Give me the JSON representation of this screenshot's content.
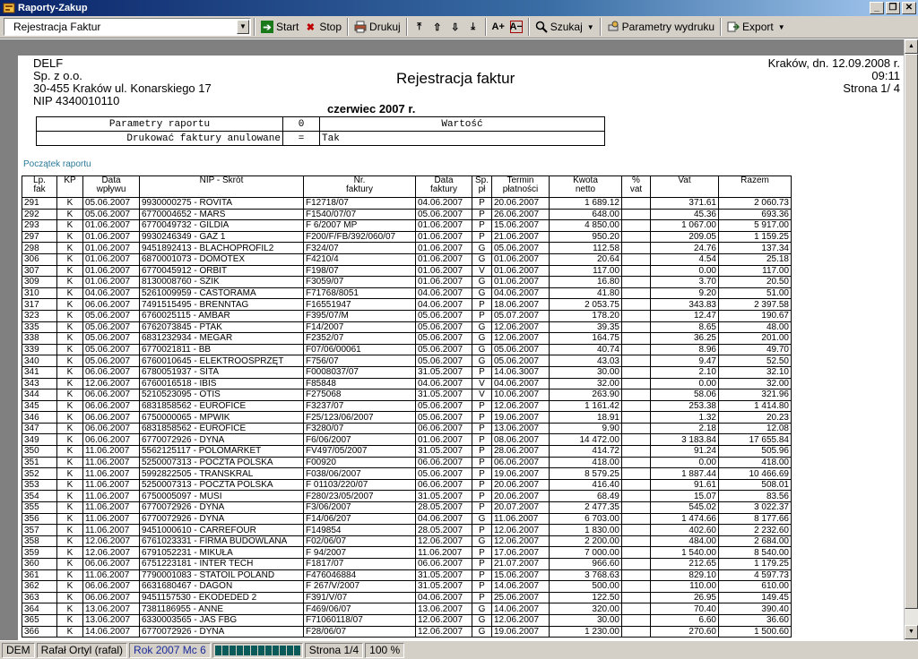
{
  "window": {
    "title": "Raporty-Zakup"
  },
  "toolbar": {
    "report_select": "Rejestracja Faktur",
    "start": "Start",
    "stop": "Stop",
    "print": "Drukuj",
    "font_up": "A+",
    "font_down": "A−",
    "search": "Szukaj",
    "print_params": "Parametry wydruku",
    "export": "Export"
  },
  "page": {
    "company": [
      "DELF",
      "Sp. z o.o.",
      "30-455 Kraków  ul. Konarskiego 17",
      "NIP  4340010110"
    ],
    "title": "Rejestracja faktur",
    "place_date": "Kraków, dn. 12.09.2008 r.",
    "time": "09:11",
    "page_label": "Strona 1/ 4",
    "period": "czerwiec 2007 r.",
    "params": {
      "header": [
        "Parametry raportu",
        "0",
        "Wartość"
      ],
      "row": [
        "Drukować faktury anulowane",
        "=",
        "Tak"
      ]
    },
    "start_label": "Początek raportu"
  },
  "table": {
    "headers": [
      [
        "Lp.",
        "fak"
      ],
      [
        "KP",
        ""
      ],
      [
        "Data",
        "wpływu"
      ],
      [
        "NIP - Skrót",
        ""
      ],
      [
        "Nr.",
        "faktury"
      ],
      [
        "Data",
        "faktury"
      ],
      [
        "Sp.",
        "pł"
      ],
      [
        "Termin",
        "płatności"
      ],
      [
        "Kwota",
        "netto"
      ],
      [
        "%",
        "vat"
      ],
      [
        "Vat",
        ""
      ],
      [
        "Razem",
        ""
      ]
    ],
    "rows": [
      [
        "291",
        "K",
        "05.06.2007",
        "9930000275 - ROVITA",
        "F12718/07",
        "04.06.2007",
        "P",
        "20.06.2007",
        "1 689.12",
        "",
        "371.61",
        "2 060.73"
      ],
      [
        "292",
        "K",
        "05.06.2007",
        "6770004652 - MARS",
        "F1540/07/07",
        "05.06.2007",
        "P",
        "26.06.2007",
        "648.00",
        "",
        "45.36",
        "693.36"
      ],
      [
        "293",
        "K",
        "01.06.2007",
        "6770049732 - GILDIA",
        "F 6/2007 MP",
        "01.06.2007",
        "P",
        "15.06.2007",
        "4 850.00",
        "",
        "1 067.00",
        "5 917.00"
      ],
      [
        "297",
        "K",
        "01.06.2007",
        "9930246349 - GAZ 1",
        "F200/F/FB/392/060/07",
        "01.06.2007",
        "P",
        "21.06.2007",
        "950.20",
        "",
        "209.05",
        "1 159.25"
      ],
      [
        "298",
        "K",
        "01.06.2007",
        "9451892413 - BLACHOPROFIL2",
        "F324/07",
        "01.06.2007",
        "G",
        "05.06.2007",
        "112.58",
        "",
        "24.76",
        "137.34"
      ],
      [
        "306",
        "K",
        "01.06.2007",
        "6870001073 - DOMOTEX",
        "F4210/4",
        "01.06.2007",
        "G",
        "01.06.2007",
        "20.64",
        "",
        "4.54",
        "25.18"
      ],
      [
        "307",
        "K",
        "01.06.2007",
        "6770045912 - ORBIT",
        "F198/07",
        "01.06.2007",
        "V",
        "01.06.2007",
        "117.00",
        "",
        "0.00",
        "117.00"
      ],
      [
        "309",
        "K",
        "01.06.2007",
        "8130008760 - SZIK",
        "F3059/07",
        "01.06.2007",
        "G",
        "01.06.2007",
        "16.80",
        "",
        "3.70",
        "20.50"
      ],
      [
        "310",
        "K",
        "04.06.2007",
        "5261009959 - CASTORAMA",
        "F71768/8051",
        "04.06.2007",
        "G",
        "04.06.2007",
        "41.80",
        "",
        "9.20",
        "51.00"
      ],
      [
        "317",
        "K",
        "06.06.2007",
        "7491515495 - BRENNTAG",
        "F16551947",
        "04.06.2007",
        "P",
        "18.06.2007",
        "2 053.75",
        "",
        "343.83",
        "2 397.58"
      ],
      [
        "323",
        "K",
        "05.06.2007",
        "6760025115 - AMBAR",
        "F395/07/M",
        "05.06.2007",
        "P",
        "05.07.2007",
        "178.20",
        "",
        "12.47",
        "190.67"
      ],
      [
        "335",
        "K",
        "05.06.2007",
        "6762073845 - PTAK",
        "F14/2007",
        "05.06.2007",
        "G",
        "12.06.2007",
        "39.35",
        "",
        "8.65",
        "48.00"
      ],
      [
        "338",
        "K",
        "05.06.2007",
        "6831232934 - MEGAR",
        "F2352/07",
        "05.06.2007",
        "G",
        "12.06.2007",
        "164.75",
        "",
        "36.25",
        "201.00"
      ],
      [
        "339",
        "K",
        "05.06.2007",
        "6770021811 - BB",
        "F07/06/00061",
        "05.06.2007",
        "G",
        "05.06.2007",
        "40.74",
        "",
        "8.96",
        "49.70"
      ],
      [
        "340",
        "K",
        "05.06.2007",
        "6760010645 - ELEKTROOSPRZĘT",
        "F756/07",
        "05.06.2007",
        "G",
        "05.06.2007",
        "43.03",
        "",
        "9.47",
        "52.50"
      ],
      [
        "341",
        "K",
        "06.06.2007",
        "6780051937 - SITA",
        "F0008037/07",
        "31.05.2007",
        "P",
        "14.06.3007",
        "30.00",
        "",
        "2.10",
        "32.10"
      ],
      [
        "343",
        "K",
        "12.06.2007",
        "6760016518 - IBIS",
        "F85848",
        "04.06.2007",
        "V",
        "04.06.2007",
        "32.00",
        "",
        "0.00",
        "32.00"
      ],
      [
        "344",
        "K",
        "06.06.2007",
        "5210523095 - OTIS",
        "F275068",
        "31.05.2007",
        "V",
        "10.06.2007",
        "263.90",
        "",
        "58.06",
        "321.96"
      ],
      [
        "345",
        "K",
        "06.06.2007",
        "6831858562 - EUROFICE",
        "F3237/07",
        "05.06.2007",
        "P",
        "12.06.2007",
        "1 161.42",
        "",
        "253.38",
        "1 414.80"
      ],
      [
        "346",
        "K",
        "06.06.2007",
        "6750000065 - MPWIK",
        "F25/123/06/2007",
        "05.06.2007",
        "P",
        "19.06.2007",
        "18.91",
        "",
        "1.32",
        "20.23"
      ],
      [
        "347",
        "K",
        "06.06.2007",
        "6831858562 - EUROFICE",
        "F3280/07",
        "06.06.2007",
        "P",
        "13.06.2007",
        "9.90",
        "",
        "2.18",
        "12.08"
      ],
      [
        "349",
        "K",
        "06.06.2007",
        "6770072926 - DYNA",
        "F6/06/2007",
        "01.06.2007",
        "P",
        "08.06.2007",
        "14 472.00",
        "",
        "3 183.84",
        "17 655.84"
      ],
      [
        "350",
        "K",
        "11.06.2007",
        "5562125117 - POLOMARKET",
        "FV497/05/2007",
        "31.05.2007",
        "P",
        "28.06.2007",
        "414.72",
        "",
        "91.24",
        "505.96"
      ],
      [
        "351",
        "K",
        "11.06.2007",
        "5250007313 - POCZTA POLSKA",
        "F00920",
        "06.06.2007",
        "P",
        "06.06.2007",
        "418.00",
        "",
        "0.00",
        "418.00"
      ],
      [
        "352",
        "K",
        "11.06.2007",
        "5992822505 - TRANSKRAL",
        "F038/06/2007",
        "05.06.2007",
        "P",
        "19.06.2007",
        "8 579.25",
        "",
        "1 887.44",
        "10 466.69"
      ],
      [
        "353",
        "K",
        "11.06.2007",
        "5250007313 - POCZTA POLSKA",
        "F 01103/220/07",
        "06.06.2007",
        "P",
        "20.06.2007",
        "416.40",
        "",
        "91.61",
        "508.01"
      ],
      [
        "354",
        "K",
        "11.06.2007",
        "6750005097 - MUSI",
        "F280/23/05/2007",
        "31.05.2007",
        "P",
        "20.06.2007",
        "68.49",
        "",
        "15.07",
        "83.56"
      ],
      [
        "355",
        "K",
        "11.06.2007",
        "6770072926 - DYNA",
        "F3/06/2007",
        "28.05.2007",
        "P",
        "20.07.2007",
        "2 477.35",
        "",
        "545.02",
        "3 022.37"
      ],
      [
        "356",
        "K",
        "11.06.2007",
        "6770072926 - DYNA",
        "F14/06/207",
        "04.06.2007",
        "G",
        "11.06.2007",
        "6 703.00",
        "",
        "1 474.66",
        "8 177.66"
      ],
      [
        "357",
        "K",
        "11.06.2007",
        "9451000610 - CARREFOUR",
        "F149854",
        "28.05.2007",
        "P",
        "12.06.2007",
        "1 830.00",
        "",
        "402.60",
        "2 232.60"
      ],
      [
        "358",
        "K",
        "12.06.2007",
        "6761023331 - FIRMA BUDOWLANA",
        "F02/06/07",
        "12.06.2007",
        "G",
        "12.06.2007",
        "2 200.00",
        "",
        "484.00",
        "2 684.00"
      ],
      [
        "359",
        "K",
        "12.06.2007",
        "6791052231 - MIKUŁA",
        "F 94/2007",
        "11.06.2007",
        "P",
        "17.06.2007",
        "7 000.00",
        "",
        "1 540.00",
        "8 540.00"
      ],
      [
        "360",
        "K",
        "06.06.2007",
        "6751223181 - INTER TECH",
        "F1817/07",
        "06.06.2007",
        "P",
        "21.07.2007",
        "966.60",
        "",
        "212.65",
        "1 179.25"
      ],
      [
        "361",
        "K",
        "11.06.2007",
        "7790001083 - STATOIL POLAND",
        "F476046884",
        "31.05.2007",
        "P",
        "15.06.2007",
        "3 768.63",
        "",
        "829.10",
        "4 597.73"
      ],
      [
        "362",
        "K",
        "06.06.2007",
        "6631680467 - DAGON",
        "F 267/V/2007",
        "31.05.2007",
        "P",
        "14.06.2007",
        "500.00",
        "",
        "110.00",
        "610.00"
      ],
      [
        "363",
        "K",
        "06.06.2007",
        "9451157530 - EKODEDED 2",
        "F391/V/07",
        "04.06.2007",
        "P",
        "25.06.2007",
        "122.50",
        "",
        "26.95",
        "149.45"
      ],
      [
        "364",
        "K",
        "13.06.2007",
        "7381186955 - ANNE",
        "F469/06/07",
        "13.06.2007",
        "G",
        "14.06.2007",
        "320.00",
        "",
        "70.40",
        "390.40"
      ],
      [
        "365",
        "K",
        "13.06.2007",
        "6330003565 - JAS FBG",
        "F71060118/07",
        "12.06.2007",
        "G",
        "12.06.2007",
        "30.00",
        "",
        "6.60",
        "36.60"
      ],
      [
        "366",
        "K",
        "14.06.2007",
        "6770072926 - DYNA",
        "F28/06/07",
        "12.06.2007",
        "G",
        "19.06.2007",
        "1 230.00",
        "",
        "270.60",
        "1 500.60"
      ]
    ]
  },
  "status": {
    "company": "DEM",
    "user": "Rafał Ortyl (rafal)",
    "year": "Rok 2007",
    "month": "Mc 6",
    "progress": 1.0,
    "page": "Strona 1/4",
    "zoom": "100 %"
  }
}
